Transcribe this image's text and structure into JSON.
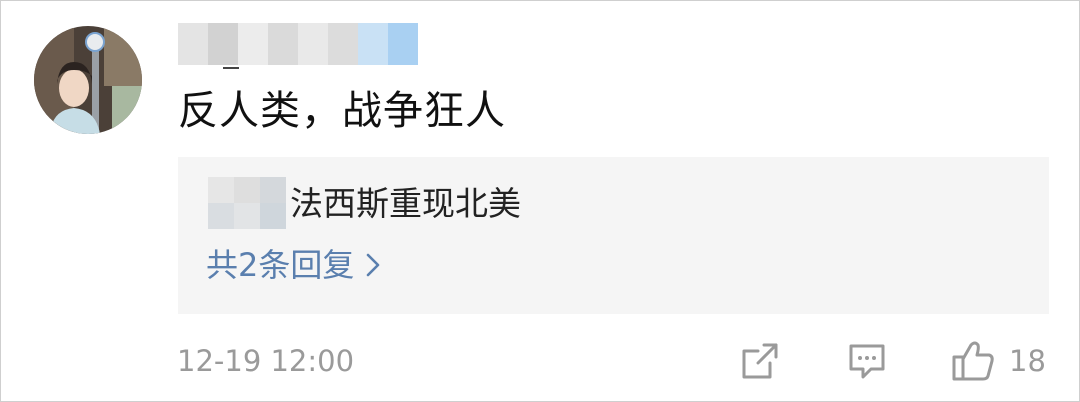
{
  "comment": {
    "text": "反人类，战争狂人",
    "timestamp": "12-19 12:00"
  },
  "reply": {
    "text": "法西斯重现北美",
    "more_label": "共2条回复"
  },
  "actions": {
    "share_icon": "share-icon",
    "reply_icon": "comment-icon",
    "like_icon": "thumbs-up-icon",
    "like_count": "18"
  },
  "colors": {
    "link": "#5a7fae",
    "muted": "#9a9a9a",
    "reply_bg": "#f5f5f5"
  }
}
